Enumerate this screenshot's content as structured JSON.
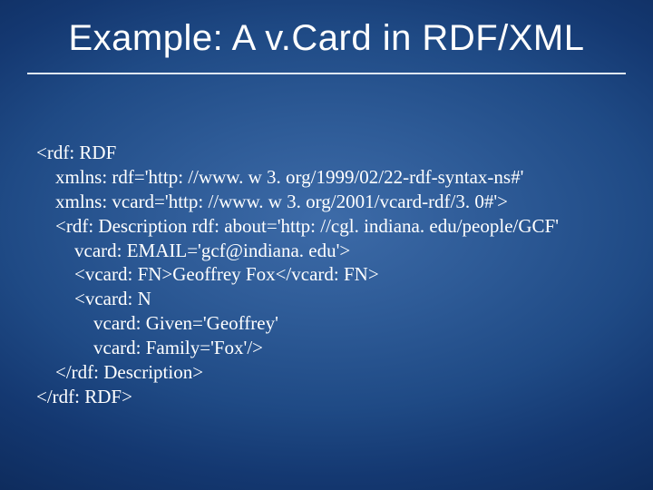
{
  "title": "Example: A v.Card in RDF/XML",
  "code": {
    "l1": "<rdf: RDF",
    "l2": "    xmlns: rdf='http: //www. w 3. org/1999/02/22-rdf-syntax-ns#'",
    "l3": "    xmlns: vcard='http: //www. w 3. org/2001/vcard-rdf/3. 0#'>",
    "l4": "    <rdf: Description rdf: about='http: //cgl. indiana. edu/people/GCF'",
    "l5": "        vcard: EMAIL='gcf@indiana. edu'>",
    "l6": "        <vcard: FN>Geoffrey Fox</vcard: FN>",
    "l7": "        <vcard: N",
    "l8": "            vcard: Given='Geoffrey'",
    "l9": "            vcard: Family='Fox'/>",
    "l10": "    </rdf: Description>",
    "l11": "</rdf: RDF>"
  }
}
